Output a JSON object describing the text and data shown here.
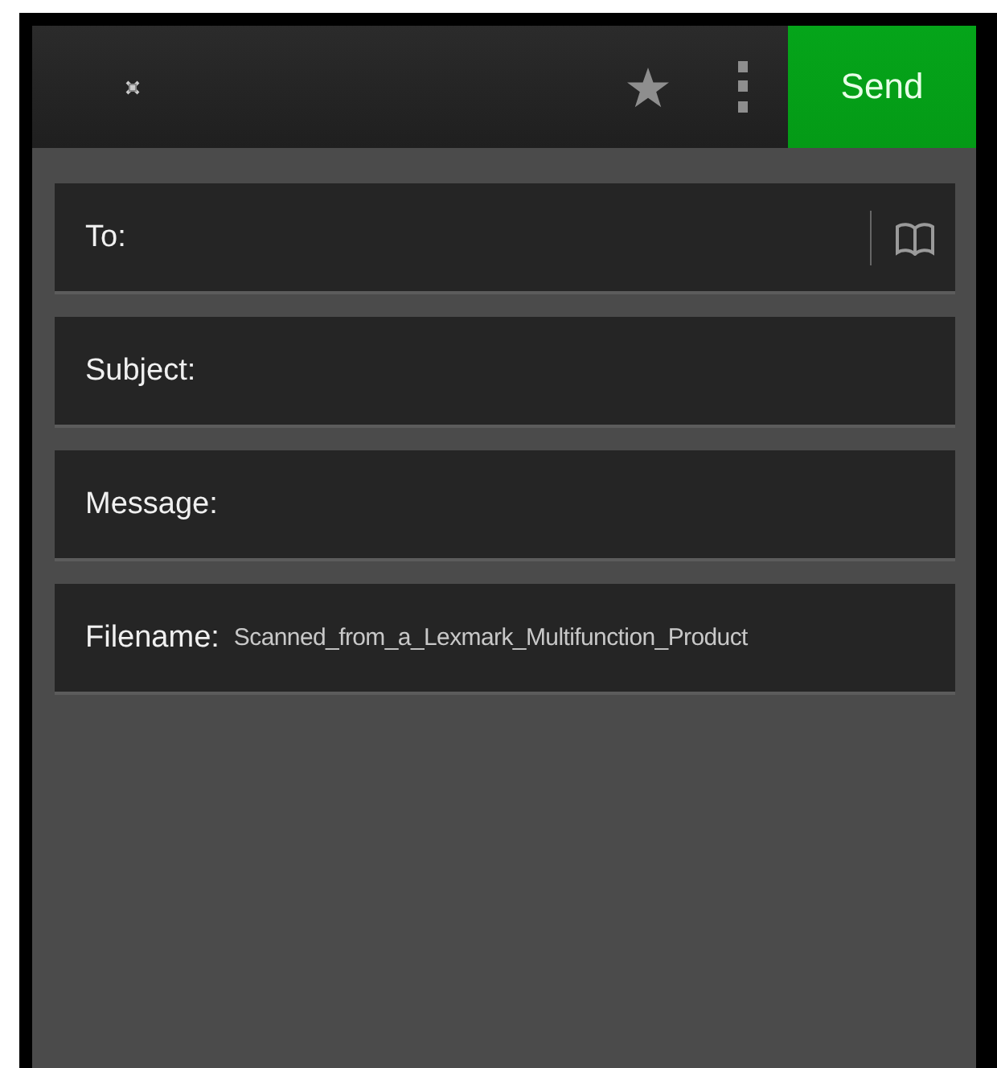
{
  "toolbar": {
    "send_button": "Send"
  },
  "fields": [
    {
      "kind": "address",
      "label": "To:"
    },
    {
      "kind": "text",
      "label": "Subject:"
    },
    {
      "kind": "text",
      "label": "Message:"
    },
    {
      "kind": "text",
      "label": "Filename:",
      "value": "Scanned_from_a_Lexmark_Multifunction_Product"
    }
  ]
}
